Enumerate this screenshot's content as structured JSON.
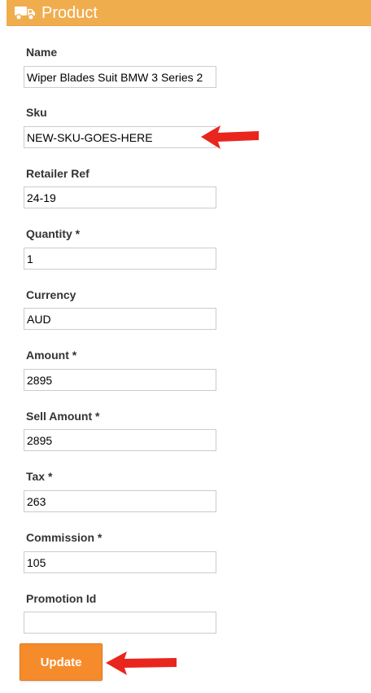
{
  "header": {
    "title": "Product",
    "icon": "truck-icon",
    "color": "#f0ad4e"
  },
  "form": {
    "name": {
      "label": "Name",
      "value": "Wiper Blades Suit BMW 3 Series 2"
    },
    "sku": {
      "label": "Sku",
      "value": "NEW-SKU-GOES-HERE"
    },
    "retailer_ref": {
      "label": "Retailer Ref",
      "value": "24-19"
    },
    "quantity": {
      "label": "Quantity *",
      "value": "1"
    },
    "currency": {
      "label": "Currency",
      "value": "AUD"
    },
    "amount": {
      "label": "Amount *",
      "value": "2895"
    },
    "sell_amount": {
      "label": "Sell Amount *",
      "value": "2895"
    },
    "tax": {
      "label": "Tax *",
      "value": "263"
    },
    "commission": {
      "label": "Commission *",
      "value": "105"
    },
    "promotion_id": {
      "label": "Promotion Id",
      "value": ""
    }
  },
  "actions": {
    "update_label": "Update",
    "button_color": "#f68b2b"
  },
  "annotations": {
    "arrow_color": "#e8261e"
  }
}
